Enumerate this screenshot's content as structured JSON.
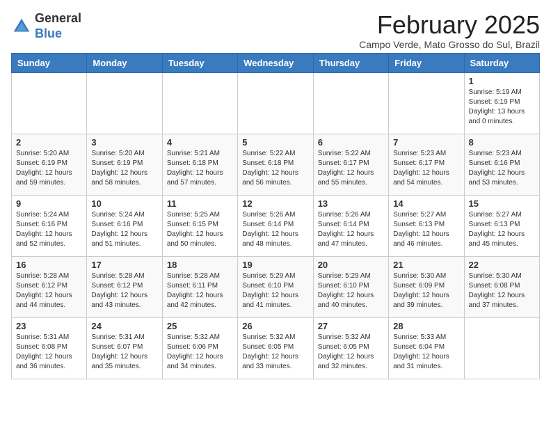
{
  "logo": {
    "general": "General",
    "blue": "Blue"
  },
  "header": {
    "month": "February 2025",
    "location": "Campo Verde, Mato Grosso do Sul, Brazil"
  },
  "weekdays": [
    "Sunday",
    "Monday",
    "Tuesday",
    "Wednesday",
    "Thursday",
    "Friday",
    "Saturday"
  ],
  "weeks": [
    [
      {
        "day": "",
        "sunrise": "",
        "sunset": "",
        "daylight": ""
      },
      {
        "day": "",
        "sunrise": "",
        "sunset": "",
        "daylight": ""
      },
      {
        "day": "",
        "sunrise": "",
        "sunset": "",
        "daylight": ""
      },
      {
        "day": "",
        "sunrise": "",
        "sunset": "",
        "daylight": ""
      },
      {
        "day": "",
        "sunrise": "",
        "sunset": "",
        "daylight": ""
      },
      {
        "day": "",
        "sunrise": "",
        "sunset": "",
        "daylight": ""
      },
      {
        "day": "1",
        "sunrise": "Sunrise: 5:19 AM",
        "sunset": "Sunset: 6:19 PM",
        "daylight": "Daylight: 13 hours and 0 minutes."
      }
    ],
    [
      {
        "day": "2",
        "sunrise": "Sunrise: 5:20 AM",
        "sunset": "Sunset: 6:19 PM",
        "daylight": "Daylight: 12 hours and 59 minutes."
      },
      {
        "day": "3",
        "sunrise": "Sunrise: 5:20 AM",
        "sunset": "Sunset: 6:19 PM",
        "daylight": "Daylight: 12 hours and 58 minutes."
      },
      {
        "day": "4",
        "sunrise": "Sunrise: 5:21 AM",
        "sunset": "Sunset: 6:18 PM",
        "daylight": "Daylight: 12 hours and 57 minutes."
      },
      {
        "day": "5",
        "sunrise": "Sunrise: 5:22 AM",
        "sunset": "Sunset: 6:18 PM",
        "daylight": "Daylight: 12 hours and 56 minutes."
      },
      {
        "day": "6",
        "sunrise": "Sunrise: 5:22 AM",
        "sunset": "Sunset: 6:17 PM",
        "daylight": "Daylight: 12 hours and 55 minutes."
      },
      {
        "day": "7",
        "sunrise": "Sunrise: 5:23 AM",
        "sunset": "Sunset: 6:17 PM",
        "daylight": "Daylight: 12 hours and 54 minutes."
      },
      {
        "day": "8",
        "sunrise": "Sunrise: 5:23 AM",
        "sunset": "Sunset: 6:16 PM",
        "daylight": "Daylight: 12 hours and 53 minutes."
      }
    ],
    [
      {
        "day": "9",
        "sunrise": "Sunrise: 5:24 AM",
        "sunset": "Sunset: 6:16 PM",
        "daylight": "Daylight: 12 hours and 52 minutes."
      },
      {
        "day": "10",
        "sunrise": "Sunrise: 5:24 AM",
        "sunset": "Sunset: 6:16 PM",
        "daylight": "Daylight: 12 hours and 51 minutes."
      },
      {
        "day": "11",
        "sunrise": "Sunrise: 5:25 AM",
        "sunset": "Sunset: 6:15 PM",
        "daylight": "Daylight: 12 hours and 50 minutes."
      },
      {
        "day": "12",
        "sunrise": "Sunrise: 5:26 AM",
        "sunset": "Sunset: 6:14 PM",
        "daylight": "Daylight: 12 hours and 48 minutes."
      },
      {
        "day": "13",
        "sunrise": "Sunrise: 5:26 AM",
        "sunset": "Sunset: 6:14 PM",
        "daylight": "Daylight: 12 hours and 47 minutes."
      },
      {
        "day": "14",
        "sunrise": "Sunrise: 5:27 AM",
        "sunset": "Sunset: 6:13 PM",
        "daylight": "Daylight: 12 hours and 46 minutes."
      },
      {
        "day": "15",
        "sunrise": "Sunrise: 5:27 AM",
        "sunset": "Sunset: 6:13 PM",
        "daylight": "Daylight: 12 hours and 45 minutes."
      }
    ],
    [
      {
        "day": "16",
        "sunrise": "Sunrise: 5:28 AM",
        "sunset": "Sunset: 6:12 PM",
        "daylight": "Daylight: 12 hours and 44 minutes."
      },
      {
        "day": "17",
        "sunrise": "Sunrise: 5:28 AM",
        "sunset": "Sunset: 6:12 PM",
        "daylight": "Daylight: 12 hours and 43 minutes."
      },
      {
        "day": "18",
        "sunrise": "Sunrise: 5:28 AM",
        "sunset": "Sunset: 6:11 PM",
        "daylight": "Daylight: 12 hours and 42 minutes."
      },
      {
        "day": "19",
        "sunrise": "Sunrise: 5:29 AM",
        "sunset": "Sunset: 6:10 PM",
        "daylight": "Daylight: 12 hours and 41 minutes."
      },
      {
        "day": "20",
        "sunrise": "Sunrise: 5:29 AM",
        "sunset": "Sunset: 6:10 PM",
        "daylight": "Daylight: 12 hours and 40 minutes."
      },
      {
        "day": "21",
        "sunrise": "Sunrise: 5:30 AM",
        "sunset": "Sunset: 6:09 PM",
        "daylight": "Daylight: 12 hours and 39 minutes."
      },
      {
        "day": "22",
        "sunrise": "Sunrise: 5:30 AM",
        "sunset": "Sunset: 6:08 PM",
        "daylight": "Daylight: 12 hours and 37 minutes."
      }
    ],
    [
      {
        "day": "23",
        "sunrise": "Sunrise: 5:31 AM",
        "sunset": "Sunset: 6:08 PM",
        "daylight": "Daylight: 12 hours and 36 minutes."
      },
      {
        "day": "24",
        "sunrise": "Sunrise: 5:31 AM",
        "sunset": "Sunset: 6:07 PM",
        "daylight": "Daylight: 12 hours and 35 minutes."
      },
      {
        "day": "25",
        "sunrise": "Sunrise: 5:32 AM",
        "sunset": "Sunset: 6:06 PM",
        "daylight": "Daylight: 12 hours and 34 minutes."
      },
      {
        "day": "26",
        "sunrise": "Sunrise: 5:32 AM",
        "sunset": "Sunset: 6:05 PM",
        "daylight": "Daylight: 12 hours and 33 minutes."
      },
      {
        "day": "27",
        "sunrise": "Sunrise: 5:32 AM",
        "sunset": "Sunset: 6:05 PM",
        "daylight": "Daylight: 12 hours and 32 minutes."
      },
      {
        "day": "28",
        "sunrise": "Sunrise: 5:33 AM",
        "sunset": "Sunset: 6:04 PM",
        "daylight": "Daylight: 12 hours and 31 minutes."
      },
      {
        "day": "",
        "sunrise": "",
        "sunset": "",
        "daylight": ""
      }
    ]
  ]
}
